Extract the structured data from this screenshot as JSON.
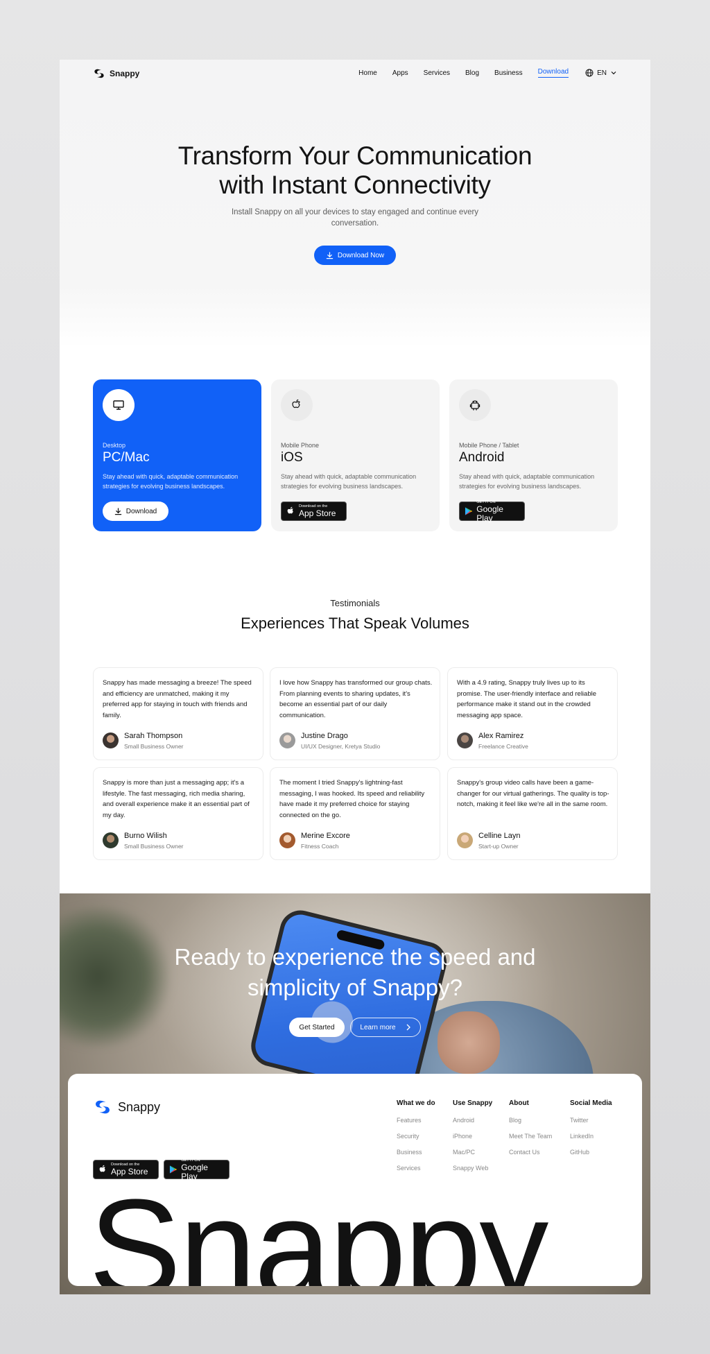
{
  "nav": {
    "brand": "Snappy",
    "links": [
      "Home",
      "Apps",
      "Services",
      "Blog",
      "Business",
      "Download"
    ],
    "active": "Download",
    "lang": "EN"
  },
  "hero": {
    "title_line1": "Transform Your Communication",
    "title_line2": "with Instant Connectivity",
    "subtitle": "Install Snappy on all your devices to stay engaged and continue every conversation.",
    "cta": "Download Now"
  },
  "platforms": [
    {
      "sub": "Desktop",
      "title": "PC/Mac",
      "desc": "Stay ahead with quick, adaptable communication strategies for evolving business landscapes.",
      "action": "Download",
      "icon": "monitor-icon"
    },
    {
      "sub": "Mobile Phone",
      "title": "iOS",
      "desc": "Stay ahead with quick, adaptable communication strategies for evolving business landscapes.",
      "store_small": "Download on the",
      "store_big": "App Store",
      "icon": "apple-icon"
    },
    {
      "sub": "Mobile Phone / Tablet",
      "title": "Android",
      "desc": "Stay ahead with quick, adaptable communication strategies for evolving business landscapes.",
      "store_small": "GET IT ON",
      "store_big": "Google Play",
      "icon": "android-icon"
    }
  ],
  "testimonials": {
    "label": "Testimonials",
    "title": "Experiences That Speak Volumes",
    "items": [
      {
        "quote": "Snappy has made messaging a breeze! The speed and efficiency are unmatched, making it my preferred app for staying in touch with friends and family.",
        "name": "Sarah Thompson",
        "role": "Small Business Owner"
      },
      {
        "quote": "I love how Snappy has transformed our group chats. From planning events to sharing updates, it's become an essential part of our daily communication.",
        "name": "Justine Drago",
        "role": "UI/UX Designer, Kretya Studio"
      },
      {
        "quote": "With a 4.9 rating, Snappy truly lives up to its promise. The user-friendly interface and reliable performance make it stand out in the crowded messaging app space.",
        "name": "Alex Ramirez",
        "role": "Freelance Creative"
      },
      {
        "quote": "Snappy is more than just a messaging app; it's a lifestyle. The fast messaging, rich media sharing, and overall experience make it an essential part of my day.",
        "name": "Burno Wilish",
        "role": "Small Business Owner"
      },
      {
        "quote": "The moment I tried Snappy's lightning-fast messaging, I was hooked. Its speed and reliability have made it my preferred choice for staying connected on the go.",
        "name": "Merine Excore",
        "role": "Fitness Coach"
      },
      {
        "quote": "Snappy's group video calls have been a game-changer for our virtual gatherings. The quality is top-notch, making it feel like we're all in the same room.",
        "name": "Celline Layn",
        "role": "Start-up Owner"
      }
    ]
  },
  "cta": {
    "title_line1": "Ready to experience the speed and",
    "title_line2": "simplicity of Snappy?",
    "primary": "Get Started",
    "secondary": "Learn more"
  },
  "footer": {
    "brand": "Snappy",
    "columns": [
      {
        "heading": "What we do",
        "items": [
          "Features",
          "Security",
          "Business",
          "Services"
        ]
      },
      {
        "heading": "Use Snappy",
        "items": [
          "Android",
          "iPhone",
          "Mac/PC",
          "Snappy Web"
        ]
      },
      {
        "heading": "About",
        "items": [
          "Blog",
          "Meet The Team",
          "Contact Us"
        ]
      },
      {
        "heading": "Social Media",
        "items": [
          "Twitter",
          "LinkedIn",
          "GitHub"
        ]
      }
    ],
    "app_store_small": "Download on the",
    "app_store_big": "App Store",
    "play_small": "GET IT ON",
    "play_big": "Google Play",
    "wordmark": "Snappy"
  },
  "colors": {
    "accent": "#1161f7",
    "text": "#141414",
    "muted": "#777777"
  }
}
